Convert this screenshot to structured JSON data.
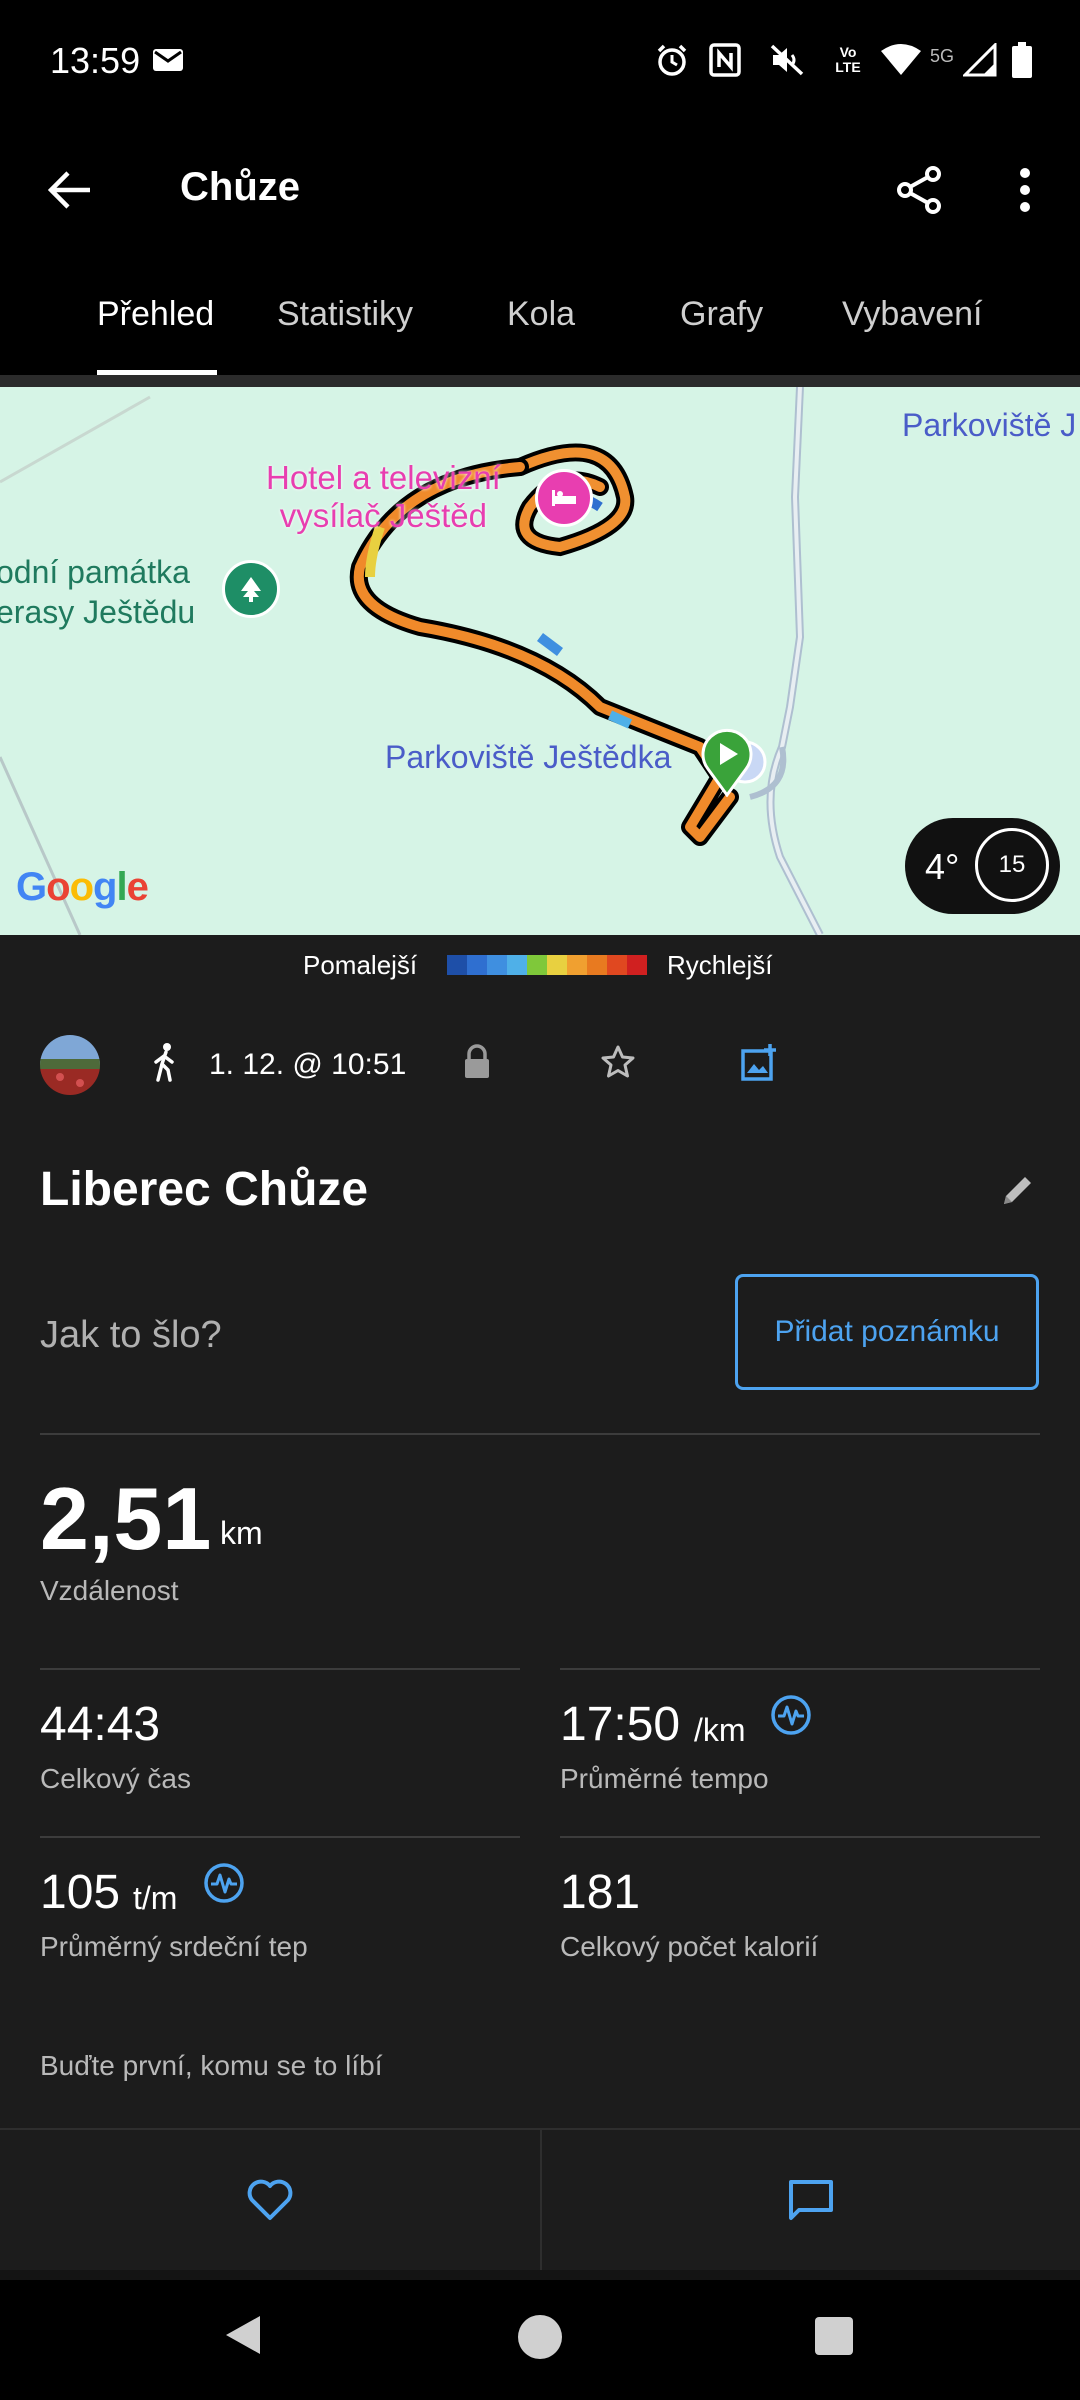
{
  "status_bar": {
    "time": "13:59",
    "network": "5G",
    "icons": [
      "mail-icon",
      "alarm-icon",
      "nfc-icon",
      "mute-icon",
      "volte-icon",
      "wifi-icon",
      "signal-icon",
      "battery-icon"
    ]
  },
  "app_bar": {
    "title": "Chůze",
    "back_icon": "back-arrow-icon",
    "share_icon": "share-icon",
    "more_icon": "more-vert-icon"
  },
  "tabs": [
    {
      "label": "Přehled",
      "active": true
    },
    {
      "label": "Statistiky",
      "active": false
    },
    {
      "label": "Kola",
      "active": false
    },
    {
      "label": "Grafy",
      "active": false
    },
    {
      "label": "Vybavení",
      "active": false
    }
  ],
  "map": {
    "poi_hotel": "Hotel a televizní\nvysílač Ještěd",
    "poi_hotel_line1": "Hotel a televizní",
    "poi_hotel_line2": "vysílač Ještěd",
    "poi_monument_line1": "odní památka",
    "poi_monument_line2": "erasy Ještědu",
    "poi_parking": "Parkoviště Ještědka",
    "poi_parking_top": "Parkoviště J",
    "google_logo": "Google",
    "weather_temp": "4°",
    "weather_wind": "15"
  },
  "legend": {
    "slower": "Pomalejší",
    "faster": "Rychlejší",
    "colors": [
      "#1e4fa8",
      "#2f6fd0",
      "#3f8fe0",
      "#4fb0e8",
      "#7fc83a",
      "#e8d040",
      "#f0a030",
      "#e87a20",
      "#e04820",
      "#d02020"
    ]
  },
  "meta": {
    "activity_icon": "walking-icon",
    "date": "1. 12. @ 10:51",
    "privacy_icon": "lock-icon",
    "favorite_icon": "star-icon",
    "photo_icon": "add-photo-icon"
  },
  "activity": {
    "name": "Liberec Chůze",
    "edit_icon": "pencil-icon",
    "note_placeholder": "Jak to šlo?",
    "note_button": "Přidat poznámku"
  },
  "stats": {
    "distance_value": "2,51",
    "distance_unit": "km",
    "distance_label": "Vzdálenost",
    "total_time_value": "44:43",
    "total_time_label": "Celkový čas",
    "avg_pace_value": "17:50",
    "avg_pace_unit": "/km",
    "avg_pace_label": "Průměrné tempo",
    "avg_hr_value": "105",
    "avg_hr_unit": "t/m",
    "avg_hr_label": "Průměrný srdeční tep",
    "calories_value": "181",
    "calories_label": "Celkový počet kalorií"
  },
  "social": {
    "like_prompt": "Buďte první, komu se to líbí",
    "like_icon": "heart-icon",
    "comment_icon": "comment-icon"
  },
  "colors": {
    "accent": "#4da3f0",
    "background": "#1c1c1c",
    "map_bg": "#d6f4e6"
  }
}
